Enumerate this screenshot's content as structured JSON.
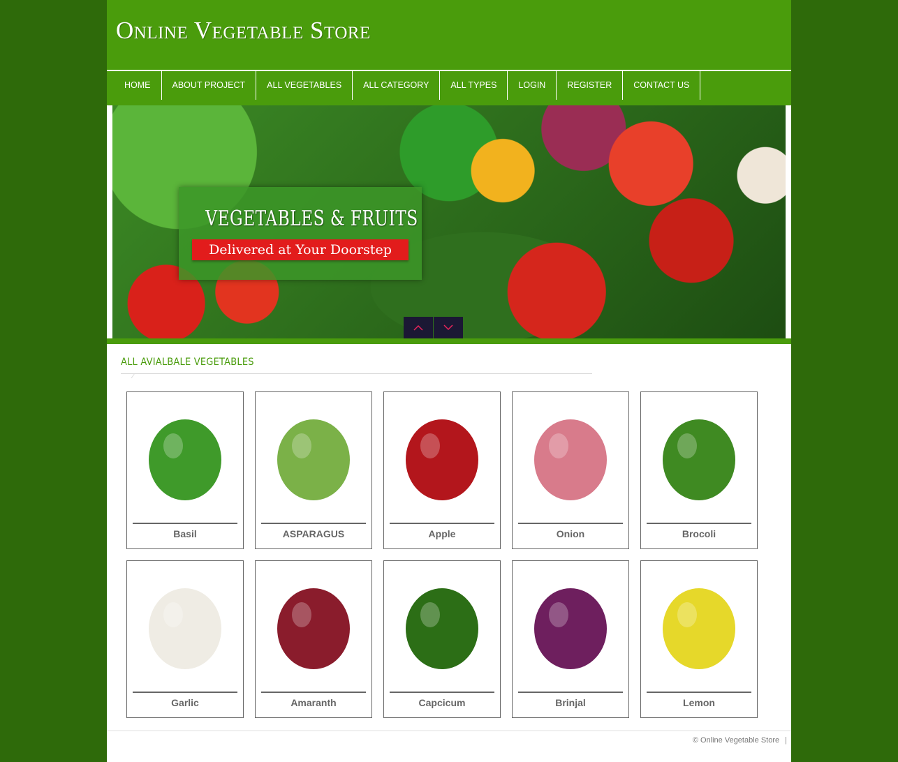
{
  "header": {
    "title": "Online Vegetable Store"
  },
  "nav": {
    "items": [
      {
        "label": "HOME"
      },
      {
        "label": "ABOUT PROJECT"
      },
      {
        "label": "ALL VEGETABLES"
      },
      {
        "label": "ALL CATEGORY"
      },
      {
        "label": "ALL TYPES"
      },
      {
        "label": "LOGIN"
      },
      {
        "label": "REGISTER"
      },
      {
        "label": "CONTACT US"
      }
    ]
  },
  "banner": {
    "headline": "VEGETABLES & FRUITS",
    "subline": "Delivered at Your Doorstep",
    "prev_icon": "chevron-up-icon",
    "next_icon": "chevron-down-icon"
  },
  "section": {
    "title": "ALL AVIALBALE VEGETABLES"
  },
  "products": [
    {
      "name": "Basil",
      "color": "#3f9a2a"
    },
    {
      "name": "ASPARAGUS",
      "color": "#7bb148"
    },
    {
      "name": "Apple",
      "color": "#b3161c"
    },
    {
      "name": "Onion",
      "color": "#d87b8b"
    },
    {
      "name": "Brocoli",
      "color": "#3f8a22"
    },
    {
      "name": "Garlic",
      "color": "#efece4"
    },
    {
      "name": "Amaranth",
      "color": "#8a1c2c"
    },
    {
      "name": "Capcicum",
      "color": "#2c6e16"
    },
    {
      "name": "Brinjal",
      "color": "#6e1f5e"
    },
    {
      "name": "Lemon",
      "color": "#e6d82a"
    }
  ],
  "footer": {
    "copyright": "© Online Vegetable Store",
    "separator": "|"
  },
  "colors": {
    "brand_green": "#4a9c0c",
    "outer_bg": "#2e6a0a",
    "slider_btn": "#1b1834",
    "chevron": "#e8245a"
  }
}
